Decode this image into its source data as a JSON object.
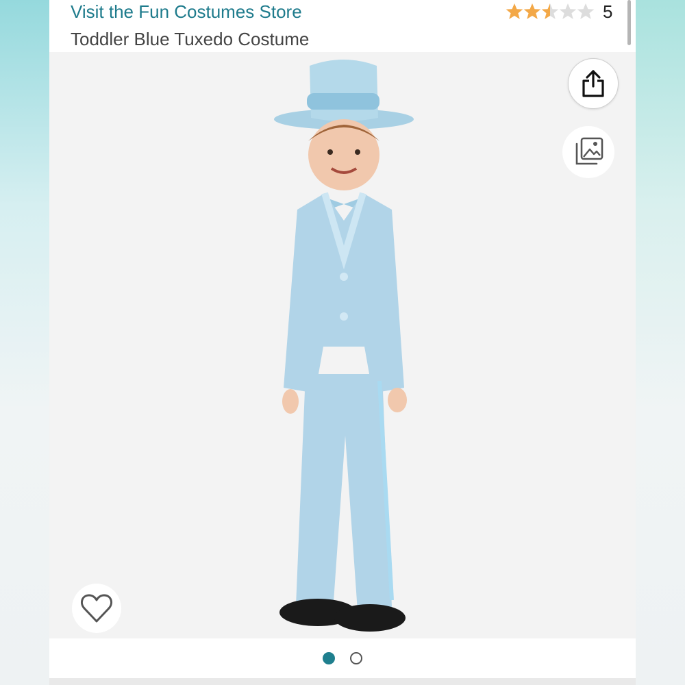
{
  "header": {
    "store_link": "Visit the Fun Costumes Store",
    "product_title": "Toddler Blue Tuxedo Costume",
    "rating": {
      "stars": 2.5,
      "max_stars": 5,
      "count": "5",
      "filled_color": "#f3a847",
      "empty_color": "#dddddd"
    }
  },
  "image_viewer": {
    "share_icon": "share-icon",
    "gallery_icon": "gallery-icon",
    "wishlist_icon": "heart-icon",
    "background_color": "#f3f3f3"
  },
  "carousel": {
    "total": 2,
    "active_index": 0,
    "active_color": "#1f7f8e"
  }
}
